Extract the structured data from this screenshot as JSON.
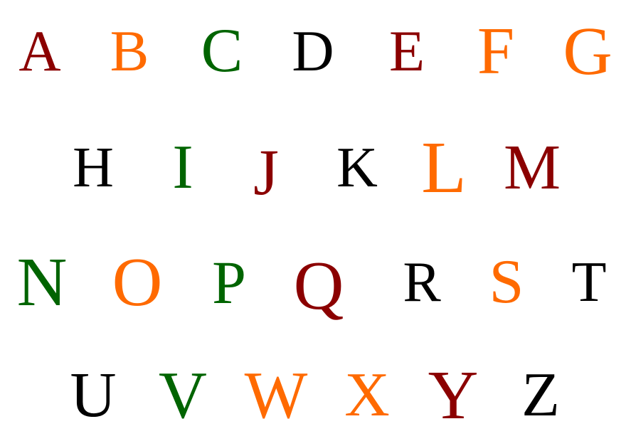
{
  "letters": [
    {
      "char": "A",
      "color": "#8b0000"
    },
    {
      "char": "B",
      "color": "#ff6a00"
    },
    {
      "char": "C",
      "color": "#006400"
    },
    {
      "char": "D",
      "color": "#000000"
    },
    {
      "char": "E",
      "color": "#8b0000"
    },
    {
      "char": "F",
      "color": "#ff6a00"
    },
    {
      "char": "G",
      "color": "#ff6a00"
    },
    {
      "char": "H",
      "color": "#000000"
    },
    {
      "char": "I",
      "color": "#006400"
    },
    {
      "char": "J",
      "color": "#8b0000"
    },
    {
      "char": "K",
      "color": "#000000"
    },
    {
      "char": "L",
      "color": "#ff6a00"
    },
    {
      "char": "M",
      "color": "#8b0000"
    },
    {
      "char": "N",
      "color": "#006400"
    },
    {
      "char": "O",
      "color": "#ff6a00"
    },
    {
      "char": "P",
      "color": "#006400"
    },
    {
      "char": "Q",
      "color": "#8b0000"
    },
    {
      "char": "R",
      "color": "#000000"
    },
    {
      "char": "S",
      "color": "#ff6a00"
    },
    {
      "char": "T",
      "color": "#000000"
    },
    {
      "char": "U",
      "color": "#000000"
    },
    {
      "char": "V",
      "color": "#006400"
    },
    {
      "char": "W",
      "color": "#ff6a00"
    },
    {
      "char": "X",
      "color": "#ff6a00"
    },
    {
      "char": "Y",
      "color": "#8b0000"
    },
    {
      "char": "Z",
      "color": "#000000"
    }
  ]
}
